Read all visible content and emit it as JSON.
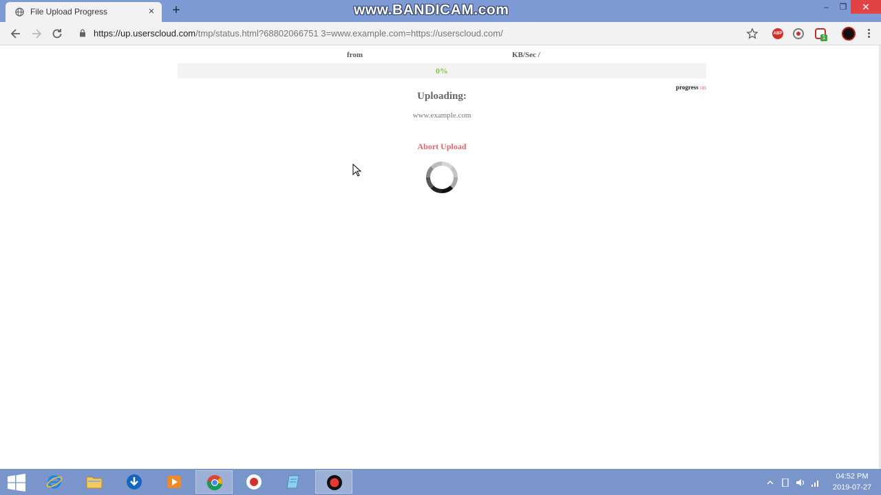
{
  "browser": {
    "tab_title": "File Upload Progress",
    "tab_close_glyph": "×",
    "new_tab_glyph": "+",
    "watermark": "www.BANDICAM.com",
    "window_min_glyph": "–",
    "window_restore_glyph": "❐",
    "window_close_glyph": "✕",
    "url_host": "https://up.userscloud.com",
    "url_path": "/tmp/status.html?68802066751 3=www.example.com=https://userscloud.com/",
    "extensions": {
      "abp_label": "ABP",
      "badge_count": "1"
    }
  },
  "page": {
    "from_label": "from",
    "speed_label": "KB/Sec  /",
    "progress_percent_text": "0%",
    "progress_value": 0,
    "progress_note_prefix": "progress",
    "progress_note_state": "on",
    "uploading_label": "Uploading:",
    "file_name": "www.example.com",
    "abort_label": "Abort Upload"
  },
  "taskbar": {
    "clock_time": "04:52 PM",
    "clock_date": "2019-07-27"
  },
  "colors": {
    "tabstrip": "#7f9bd6",
    "progress_green": "#8bc34a",
    "abort_red": "#e06666",
    "taskbar": "#7a95ca"
  },
  "icons": {
    "tab": "globe-icon",
    "back": "arrow-left-icon",
    "forward": "arrow-right-icon",
    "reload": "reload-icon",
    "lock": "lock-icon",
    "bookmark": "star-icon",
    "spinner": "loading-spinner-icon"
  }
}
